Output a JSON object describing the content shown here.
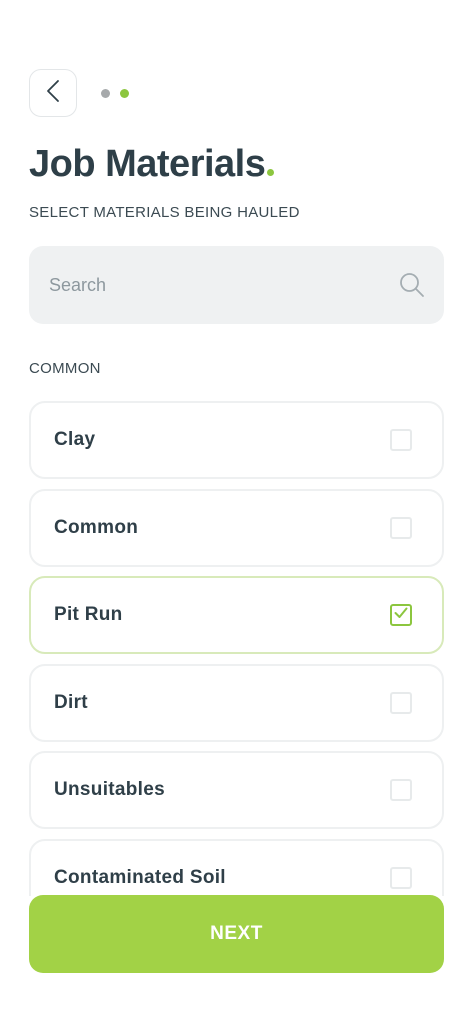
{
  "header": {
    "back_icon": "chevron-left-icon",
    "steps": [
      {
        "state": "inactive",
        "color": "#a6a9ab"
      },
      {
        "state": "active",
        "color": "#8cc63f"
      }
    ],
    "title": "Job Materials",
    "title_accent_color": "#8cc63f",
    "subtitle": "SELECT MATERIALS BEING HAULED"
  },
  "search": {
    "placeholder": "Search",
    "value": "",
    "icon": "search-icon"
  },
  "section": {
    "label": "COMMON"
  },
  "materials": [
    {
      "label": "Clay",
      "checked": false
    },
    {
      "label": "Common",
      "checked": false
    },
    {
      "label": "Pit Run",
      "checked": true
    },
    {
      "label": "Dirt",
      "checked": false
    },
    {
      "label": "Unsuitables",
      "checked": false
    },
    {
      "label": "Contaminated Soil",
      "checked": false
    }
  ],
  "footer": {
    "next_label": "NEXT",
    "next_color": "#a2d246"
  },
  "colors": {
    "accent": "#8cc63f",
    "text": "#2e3f48",
    "search_bg": "#eff1f2"
  }
}
